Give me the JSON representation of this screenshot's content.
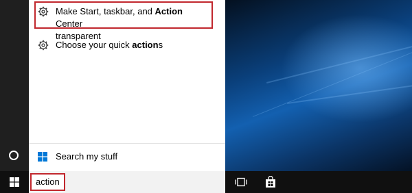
{
  "results": [
    {
      "pre": "Make Start, taskbar, and ",
      "bold": "Action",
      "post": " Center",
      "line2": "transparent",
      "icon": "gear-icon"
    },
    {
      "pre": "Choose your quick ",
      "bold": "action",
      "post": "s",
      "icon": "gear-icon"
    }
  ],
  "search_my_stuff": {
    "label": "Search my stuff",
    "icon": "windows-logo-icon"
  },
  "search": {
    "value": "action"
  },
  "taskbar": {
    "icons": [
      "windows-start-icon",
      "task-view-icon",
      "store-icon"
    ]
  },
  "colors": {
    "highlight_border": "#c1272d",
    "accent_blue": "#0078d7",
    "taskbar": "#101010",
    "left_rail": "#1f1f1f"
  }
}
